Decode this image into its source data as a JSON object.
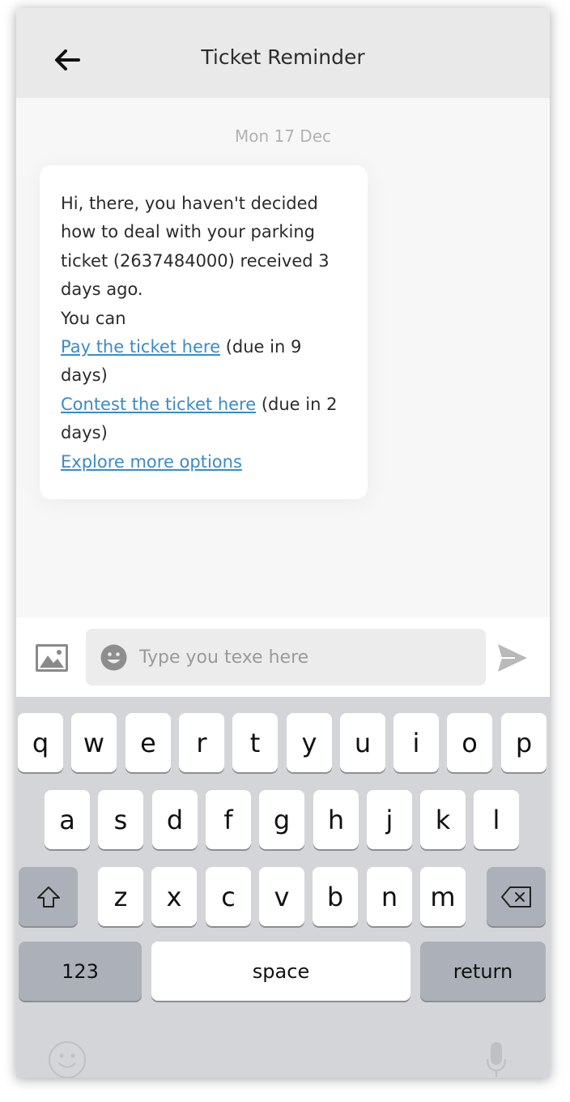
{
  "header": {
    "title": "Ticket Reminder",
    "back_icon": "arrow-left-icon"
  },
  "conversation": {
    "date": "Mon 17 Dec",
    "message": {
      "line1": "Hi, there, you haven't decided how to deal with your parking ticket (2637484000) received 3 days ago.",
      "line2": "You can",
      "pay_link": "Pay the ticket here",
      "pay_note": " (due in 9 days)",
      "contest_link": "Contest the ticket here",
      "contest_note": " (due in 2 days)",
      "explore_link": "Explore more options"
    }
  },
  "composer": {
    "placeholder": "Type you texe here",
    "image_icon": "image-icon",
    "emoji_icon": "smiley-icon",
    "send_icon": "send-icon"
  },
  "keyboard": {
    "row1": [
      "q",
      "w",
      "e",
      "r",
      "t",
      "y",
      "u",
      "i",
      "o",
      "p"
    ],
    "row2": [
      "a",
      "s",
      "d",
      "f",
      "g",
      "h",
      "j",
      "k",
      "l"
    ],
    "row3": [
      "z",
      "x",
      "c",
      "v",
      "b",
      "n",
      "m"
    ],
    "numbers_label": "123",
    "space_label": "space",
    "return_label": "return",
    "shift_icon": "shift-icon",
    "backspace_icon": "backspace-icon"
  },
  "colors": {
    "link": "#3a8bc9",
    "header_bg": "#e9e9e9",
    "keyboard_bg": "#d3d5d9"
  }
}
